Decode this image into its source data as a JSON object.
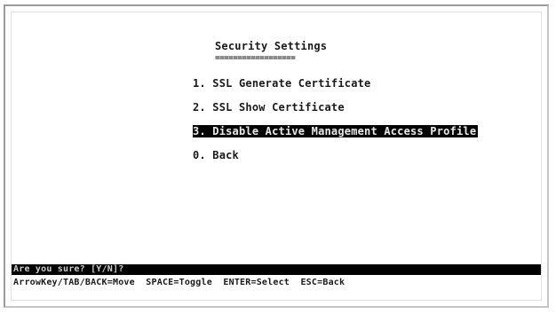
{
  "screen": {
    "title": "Security Settings",
    "title_underline": "=================="
  },
  "menu": {
    "items": [
      {
        "label": "1. SSL Generate Certificate"
      },
      {
        "label": "2. SSL Show Certificate"
      },
      {
        "label": "3. Disable Active Management Access Profile"
      },
      {
        "label": "0. Back"
      }
    ],
    "selected_index": 2
  },
  "status": {
    "prompt": "Are you sure? [Y/N]?"
  },
  "help": {
    "keys": "ArrowKey/TAB/BACK=Move  SPACE=Toggle  ENTER=Select  ESC=Back"
  },
  "colors": {
    "selection_bg": "#050505",
    "selection_fg": "#e9e9e9",
    "text": "#1a1a1a"
  }
}
